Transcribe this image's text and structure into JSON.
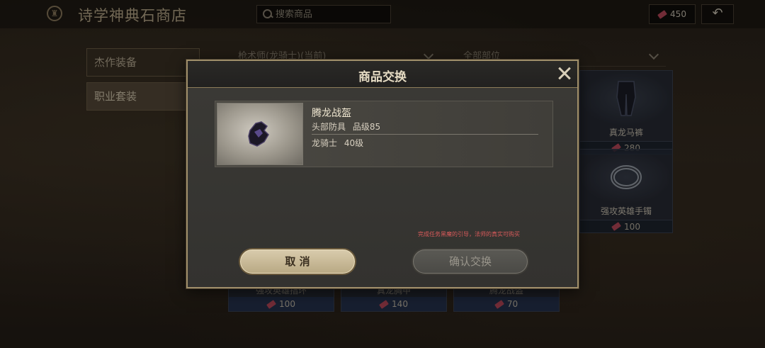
{
  "shop": {
    "title": "诗学神典石商店",
    "search_placeholder": "搜索商品",
    "currency_amount": "450"
  },
  "tabs": [
    {
      "label": "杰作装备",
      "active": false
    },
    {
      "label": "职业套装",
      "active": true
    }
  ],
  "filters": {
    "class": "枪术师(龙骑士)(当前)",
    "slot": "全部部位"
  },
  "grid_items": [
    {
      "name": "真龙马裤",
      "price": "280"
    },
    {
      "name": "强攻英雄手镯",
      "price": "100"
    }
  ],
  "bottom_items": [
    {
      "name": "强攻英雄指环",
      "price": "100"
    },
    {
      "name": "真龙胸甲",
      "price": "140"
    },
    {
      "name": "腾龙战盔",
      "price": "70"
    }
  ],
  "modal": {
    "title": "商品交换",
    "item": {
      "name": "腾龙战盔",
      "slot": "头部防具",
      "item_level": "品级85",
      "job_req": "龙骑士",
      "level_req": "40级"
    },
    "warning": "完成任务黑魔的引导，法师的真实可购买",
    "cancel_label": "取 消",
    "confirm_label": "确认交换"
  },
  "colors": {
    "frame_gold": "#a08f6a",
    "warning_red": "#d85a5a",
    "gem_red": "#b8485a"
  }
}
